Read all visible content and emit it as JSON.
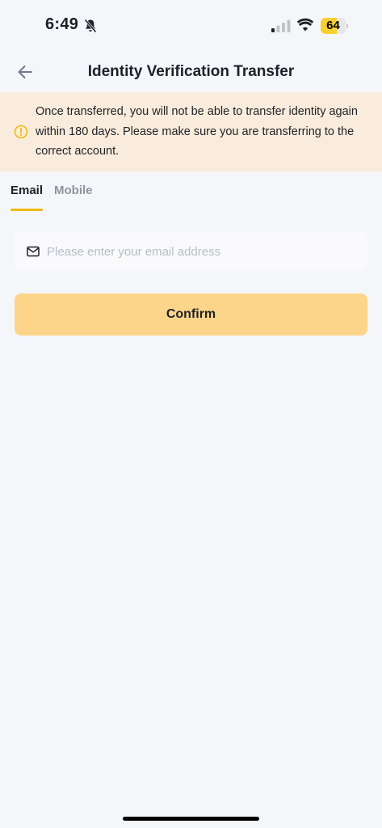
{
  "status_bar": {
    "time": "6:49",
    "battery_percent": 64,
    "battery_label": "64",
    "battery_color": "#f7d131",
    "signal_bars_active": 1,
    "icons": [
      "bell-slash-icon",
      "signal-icon",
      "wifi-icon",
      "battery-icon"
    ]
  },
  "header": {
    "title": "Identity Verification Transfer",
    "back_icon": "arrow-left-icon"
  },
  "warning": {
    "icon": "warning-circle-icon",
    "text": "Once transferred, you will not be able to transfer identity again within 180 days. Please make sure you are transferring to the correct account.",
    "background": "#f9ecdc",
    "icon_color": "#f0b90b"
  },
  "tabs": [
    {
      "label": "Email",
      "active": true
    },
    {
      "label": "Mobile",
      "active": false
    }
  ],
  "form": {
    "email_icon": "mail-icon",
    "email_placeholder": "Please enter your email address",
    "email_value": "",
    "confirm_label": "Confirm",
    "confirm_color": "#fcd58b"
  },
  "colors": {
    "accent": "#f0b90b",
    "background": "#f5f6fa",
    "text_primary": "#1e2026",
    "text_secondary": "#8f939c"
  }
}
